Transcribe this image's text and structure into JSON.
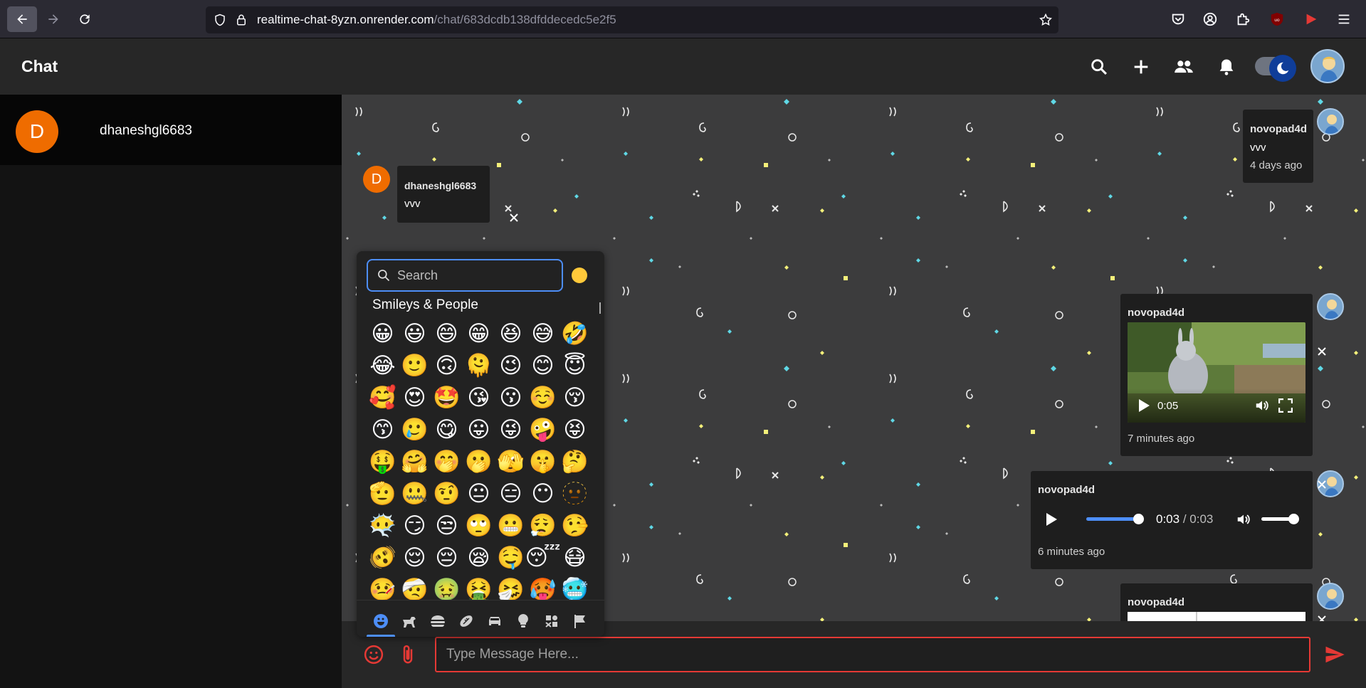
{
  "browser": {
    "url_host": "realtime-chat-8yzn.onrender.com",
    "url_path": "/chat/683dcdb138dfddecedc5e2f5"
  },
  "app": {
    "title": "Chat"
  },
  "sidebar": {
    "contacts": [
      {
        "initial": "D",
        "name": "dhaneshgl6683"
      }
    ]
  },
  "messages": [
    {
      "sender": "novopad4d",
      "text": "vvv",
      "time": "4 days ago",
      "side": "right",
      "type": "text"
    },
    {
      "sender": "dhaneshgl6683",
      "text": "vvv",
      "initial": "D",
      "side": "left",
      "type": "text"
    },
    {
      "sender": "novopad4d",
      "time": "7 minutes ago",
      "side": "right",
      "type": "video",
      "video_time": "0:05"
    },
    {
      "sender": "novopad4d",
      "time": "6 minutes ago",
      "side": "right",
      "type": "audio",
      "current": "0:03",
      "separator": "/",
      "duration": "0:03"
    },
    {
      "sender": "novopad4d",
      "side": "right",
      "type": "image"
    }
  ],
  "emoji_picker": {
    "search_placeholder": "Search",
    "category_label": "Smileys & People",
    "emojis": [
      "😀",
      "😃",
      "😄",
      "😁",
      "😆",
      "😅",
      "🤣",
      "😂",
      "🙂",
      "🙃",
      "🫠",
      "😉",
      "😊",
      "😇",
      "🥰",
      "😍",
      "🤩",
      "😘",
      "😗",
      "☺️",
      "😚",
      "😙",
      "🥲",
      "😋",
      "😛",
      "😜",
      "🤪",
      "😝",
      "🤑",
      "🤗",
      "🤭",
      "🫢",
      "🫣",
      "🤫",
      "🤔",
      "🫡",
      "🤐",
      "🤨",
      "😐",
      "😑",
      "😶",
      "🫥",
      "😶‍🌫️",
      "😏",
      "😒",
      "🙄",
      "😬",
      "😮‍💨",
      "🤥",
      "🫨",
      "😌",
      "😔",
      "😪",
      "🤤",
      "😴",
      "😷",
      "🤒",
      "🤕",
      "🤢",
      "🤮",
      "🤧",
      "🥵",
      "🥶"
    ],
    "tabs": [
      "smileys-icon",
      "animals-icon",
      "food-icon",
      "activity-icon",
      "travel-icon",
      "objects-icon",
      "symbols-icon",
      "flags-icon"
    ]
  },
  "composer": {
    "placeholder": "Type Message Here..."
  },
  "colors": {
    "accent_red": "#e53935",
    "accent_blue": "#4d8ef7",
    "avatar_orange": "#ef6c00"
  }
}
